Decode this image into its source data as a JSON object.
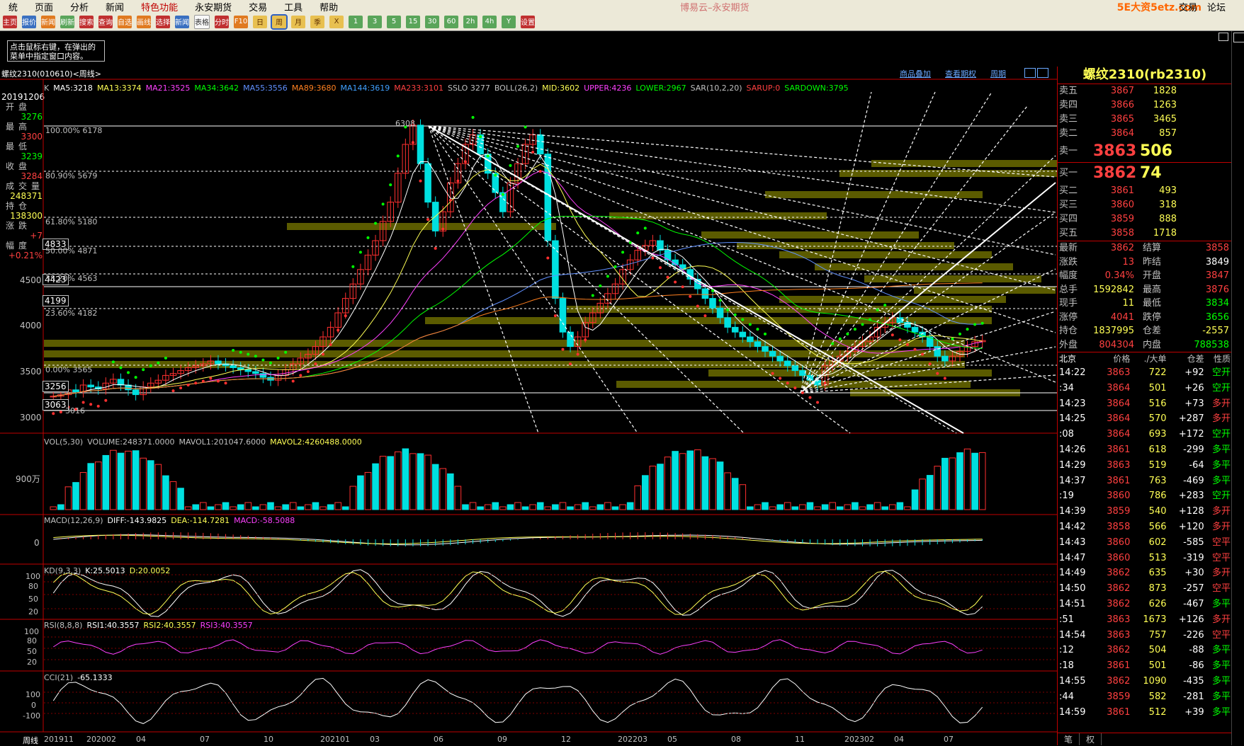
{
  "menu": [
    "统",
    "页面",
    "分析",
    "新闻",
    "特色功能",
    "永安期货",
    "交易",
    "工具",
    "帮助"
  ],
  "app_title": "博易云–永安期货",
  "menu_right": [
    "交易",
    "论坛"
  ],
  "watermark": "5E大资5etz.com",
  "toolbar": [
    "主页",
    "报价",
    "新闻",
    "刷新",
    "搜索",
    "查询",
    "自选",
    "画线",
    "选择",
    "新闻",
    "表格",
    "分时",
    "F10",
    "日",
    "周",
    "月",
    "季",
    "X",
    "1",
    "3",
    "5",
    "15",
    "30",
    "60",
    "2h",
    "4h",
    "Y",
    "设置"
  ],
  "note": "点击鼠标右键，在弹出的菜单中指定窗口内容。",
  "chart_header": {
    "title": "螺纹2310(010610)<周线>",
    "links": [
      "商品叠加",
      "查看期权",
      "周期"
    ]
  },
  "main_indicators": [
    {
      "text": "K",
      "color": "#c0c0c0"
    },
    {
      "text": "MA5:3218",
      "color": "#ffffff"
    },
    {
      "text": "MA13:3374",
      "color": "#ffff55"
    },
    {
      "text": "MA21:3525",
      "color": "#ff40ff"
    },
    {
      "text": "MA34:3642",
      "color": "#00ff00"
    },
    {
      "text": "MA55:3556",
      "color": "#6090ff"
    },
    {
      "text": "MA89:3680",
      "color": "#ff8020"
    },
    {
      "text": "MA144:3619",
      "color": "#40a0ff"
    },
    {
      "text": "MA233:3101",
      "color": "#ff4040"
    },
    {
      "text": "SSLO 3277",
      "color": "#c0c0c0"
    },
    {
      "text": "BOLL(26,2)",
      "color": "#c0c0c0"
    },
    {
      "text": "MID:3602",
      "color": "#ffff55"
    },
    {
      "text": "UPPER:4236",
      "color": "#ff40ff"
    },
    {
      "text": "LOWER:2967",
      "color": "#00ff00"
    },
    {
      "text": "SAR(10,2,20)",
      "color": "#c0c0c0"
    },
    {
      "text": "SARUP:0",
      "color": "#ff4040"
    },
    {
      "text": "SARDOWN:3795",
      "color": "#00ff00"
    }
  ],
  "sidebar": {
    "date": "20191206",
    "rows": [
      {
        "label": "开盘",
        "value": "3276",
        "color": "#00ff00"
      },
      {
        "label": "最高",
        "value": "3300",
        "color": "#ff4040"
      },
      {
        "label": "最低",
        "value": "3239",
        "color": "#00ff00"
      },
      {
        "label": "收盘",
        "value": "3284",
        "color": "#ff4040"
      },
      {
        "label": "成交量",
        "value": "248371",
        "color": "#ffff55"
      },
      {
        "label": "持仓",
        "value": "138300",
        "color": "#ffff55"
      },
      {
        "label": "涨跌",
        "value": "+7",
        "color": "#ff4040"
      },
      {
        "label": "幅度",
        "value": "+0.21%",
        "color": "#ff4040"
      }
    ]
  },
  "price_boxes": [
    "4833",
    "4423",
    "4199",
    "3256",
    "3063"
  ],
  "y_labels": [
    "4500",
    "4000",
    "3500",
    "3000"
  ],
  "fib_labels": [
    "100.00% 6178",
    "80.90% 5679",
    "61.80% 5180",
    "50.00% 4871",
    "38.20% 4563",
    "23.60% 4182",
    "0.00% 3565",
    "3016"
  ],
  "peak_label": "6308",
  "volume": {
    "title": [
      {
        "text": "VOL(5,30)",
        "color": "#c0c0c0"
      },
      {
        "text": "VOLUME:248371.0000",
        "color": "#c0c0c0"
      },
      {
        "text": "MAVOL1:201047.6000",
        "color": "#c0c0c0"
      },
      {
        "text": "MAVOL2:4260488.0000",
        "color": "#ffff55"
      }
    ],
    "y_label": "900万"
  },
  "macd": {
    "title": [
      {
        "text": "MACD(12,26,9)",
        "color": "#c0c0c0"
      },
      {
        "text": "DIFF:-143.9825",
        "color": "#ffffff"
      },
      {
        "text": "DEA:-114.7281",
        "color": "#ffff55"
      },
      {
        "text": "MACD:-58.5088",
        "color": "#ff40ff"
      }
    ],
    "y_label": "0"
  },
  "kd": {
    "title": [
      {
        "text": "KD(9,3,3)",
        "color": "#c0c0c0"
      },
      {
        "text": "K:25.5013",
        "color": "#ffffff"
      },
      {
        "text": "D:20.0052",
        "color": "#ffff55"
      }
    ],
    "y_labels": [
      "100",
      "80",
      "50",
      "20"
    ]
  },
  "rsi": {
    "title": [
      {
        "text": "RSI(8,8,8)",
        "color": "#c0c0c0"
      },
      {
        "text": "RSI1:40.3557",
        "color": "#ffffff"
      },
      {
        "text": "RSI2:40.3557",
        "color": "#ffff55"
      },
      {
        "text": "RSI3:40.3557",
        "color": "#ff40ff"
      }
    ],
    "y_labels": [
      "100",
      "80",
      "50",
      "20"
    ]
  },
  "cci": {
    "title": [
      {
        "text": "CCI(21)",
        "color": "#c0c0c0"
      },
      {
        "text": "-65.1333",
        "color": "#ffffff"
      }
    ],
    "y_labels": [
      "100",
      "0",
      "-100"
    ]
  },
  "x_axis": {
    "label": "周线",
    "ticks": [
      "201911",
      "202002",
      "04",
      "07",
      "10",
      "202101",
      "03",
      "06",
      "09",
      "12",
      "202203",
      "05",
      "08",
      "11",
      "202302",
      "04",
      "07"
    ]
  },
  "quote": {
    "title": "螺纹2310(rb2310)",
    "asks": [
      {
        "label": "卖五",
        "price": "3867",
        "vol": "1828"
      },
      {
        "label": "卖四",
        "price": "3866",
        "vol": "1263"
      },
      {
        "label": "卖三",
        "price": "3865",
        "vol": "3465"
      },
      {
        "label": "卖二",
        "price": "3864",
        "vol": "857"
      },
      {
        "label": "卖一",
        "price": "3863",
        "vol": "506"
      }
    ],
    "bids": [
      {
        "label": "买一",
        "price": "3862",
        "vol": "74"
      },
      {
        "label": "买二",
        "price": "3861",
        "vol": "493"
      },
      {
        "label": "买三",
        "price": "3860",
        "vol": "318"
      },
      {
        "label": "买四",
        "price": "3859",
        "vol": "888"
      },
      {
        "label": "买五",
        "price": "3858",
        "vol": "1718"
      }
    ],
    "stats": [
      {
        "l1": "最新",
        "v1": "3862",
        "c1": "#ff4040",
        "l2": "结算",
        "v2": "3858",
        "c2": "#ff4040"
      },
      {
        "l1": "涨跌",
        "v1": "13",
        "c1": "#ff4040",
        "l2": "昨结",
        "v2": "3849",
        "c2": "#ffffff"
      },
      {
        "l1": "幅度",
        "v1": "0.34%",
        "c1": "#ff4040",
        "l2": "开盘",
        "v2": "3847",
        "c2": "#ff4040"
      },
      {
        "l1": "总手",
        "v1": "1592842",
        "c1": "#ffff55",
        "l2": "最高",
        "v2": "3876",
        "c2": "#ff4040"
      },
      {
        "l1": "现手",
        "v1": "11",
        "c1": "#ffff55",
        "l2": "最低",
        "v2": "3834",
        "c2": "#00ff00"
      },
      {
        "l1": "涨停",
        "v1": "4041",
        "c1": "#ff4040",
        "l2": "跌停",
        "v2": "3656",
        "c2": "#00ff00"
      },
      {
        "l1": "持仓",
        "v1": "1837995",
        "c1": "#ffff55",
        "l2": "仓差",
        "v2": "-2557",
        "c2": "#ffff55"
      },
      {
        "l1": "外盘",
        "v1": "804304",
        "c1": "#ff4040",
        "l2": "内盘",
        "v2": "788538",
        "c2": "#00ff00"
      }
    ],
    "tick_header": [
      "北京",
      "价格",
      "./大单",
      "仓差",
      "性质"
    ],
    "ticks": [
      {
        "t": "14:22",
        "p": "3863",
        "v": "722",
        "c": "+92",
        "n": "空开",
        "cc": "#ffffff",
        "nc": "#00ff00"
      },
      {
        "t": ":34",
        "p": "3864",
        "v": "501",
        "c": "+26",
        "n": "空开",
        "cc": "#ffffff",
        "nc": "#00ff00"
      },
      {
        "t": "14:23",
        "p": "3864",
        "v": "516",
        "c": "+73",
        "n": "多开",
        "cc": "#ffffff",
        "nc": "#ff4040"
      },
      {
        "t": "14:25",
        "p": "3864",
        "v": "570",
        "c": "+287",
        "n": "多开",
        "cc": "#ffffff",
        "nc": "#ff4040"
      },
      {
        "t": ":08",
        "p": "3864",
        "v": "693",
        "c": "+172",
        "n": "空开",
        "cc": "#ffffff",
        "nc": "#00ff00"
      },
      {
        "t": "14:26",
        "p": "3861",
        "v": "618",
        "c": "-299",
        "n": "多平",
        "cc": "#ffffff",
        "nc": "#00ff00"
      },
      {
        "t": "14:29",
        "p": "3863",
        "v": "519",
        "c": "-64",
        "n": "多平",
        "cc": "#ffffff",
        "nc": "#00ff00"
      },
      {
        "t": "14:37",
        "p": "3861",
        "v": "763",
        "c": "-469",
        "n": "多平",
        "cc": "#ffffff",
        "nc": "#00ff00"
      },
      {
        "t": ":19",
        "p": "3860",
        "v": "786",
        "c": "+283",
        "n": "空开",
        "cc": "#ffffff",
        "nc": "#00ff00"
      },
      {
        "t": "14:39",
        "p": "3859",
        "v": "540",
        "c": "+128",
        "n": "多开",
        "cc": "#ffffff",
        "nc": "#ff4040"
      },
      {
        "t": "14:42",
        "p": "3858",
        "v": "566",
        "c": "+120",
        "n": "多开",
        "cc": "#ffffff",
        "nc": "#ff4040"
      },
      {
        "t": "14:43",
        "p": "3860",
        "v": "602",
        "c": "-585",
        "n": "空平",
        "cc": "#ffffff",
        "nc": "#ff4040"
      },
      {
        "t": "14:47",
        "p": "3860",
        "v": "513",
        "c": "-319",
        "n": "空平",
        "cc": "#ffffff",
        "nc": "#ff4040"
      },
      {
        "t": "14:49",
        "p": "3862",
        "v": "635",
        "c": "+30",
        "n": "多开",
        "cc": "#ffffff",
        "nc": "#ff4040"
      },
      {
        "t": "14:50",
        "p": "3862",
        "v": "873",
        "c": "-257",
        "n": "空平",
        "cc": "#ffffff",
        "nc": "#ff4040"
      },
      {
        "t": "14:51",
        "p": "3862",
        "v": "626",
        "c": "-467",
        "n": "多平",
        "cc": "#ffffff",
        "nc": "#00ff00"
      },
      {
        "t": ":51",
        "p": "3863",
        "v": "1673",
        "c": "+126",
        "n": "多开",
        "cc": "#ffffff",
        "nc": "#ff4040"
      },
      {
        "t": "14:54",
        "p": "3863",
        "v": "757",
        "c": "-226",
        "n": "空平",
        "cc": "#ffffff",
        "nc": "#ff4040"
      },
      {
        "t": ":12",
        "p": "3862",
        "v": "504",
        "c": "-88",
        "n": "多平",
        "cc": "#ffffff",
        "nc": "#00ff00"
      },
      {
        "t": ":18",
        "p": "3861",
        "v": "501",
        "c": "-86",
        "n": "多平",
        "cc": "#ffffff",
        "nc": "#00ff00"
      },
      {
        "t": "14:55",
        "p": "3862",
        "v": "1090",
        "c": "-435",
        "n": "多平",
        "cc": "#ffffff",
        "nc": "#00ff00"
      },
      {
        "t": ":44",
        "p": "3859",
        "v": "582",
        "c": "-281",
        "n": "多平",
        "cc": "#ffffff",
        "nc": "#00ff00"
      },
      {
        "t": "14:59",
        "p": "3861",
        "v": "512",
        "c": "+39",
        "n": "多平",
        "cc": "#ffffff",
        "nc": "#00ff00"
      }
    ],
    "footer": [
      "笔",
      "权"
    ]
  },
  "chart_data": {
    "type": "candlestick",
    "period": "weekly",
    "symbol": "螺纹2310",
    "y_ticks": [
      3000,
      3500,
      4000,
      4500
    ],
    "ylim": [
      2900,
      6400
    ],
    "x_ticks": [
      "201911",
      "202002",
      "04",
      "07",
      "10",
      "202101",
      "03",
      "06",
      "09",
      "12",
      "202203",
      "05",
      "08",
      "11",
      "202302",
      "04",
      "07"
    ],
    "closes": [
      3284,
      3300,
      3350,
      3330,
      3400,
      3380,
      3360,
      3420,
      3460,
      3400,
      3350,
      3300,
      3380,
      3420,
      3450,
      3500,
      3520,
      3550,
      3580,
      3600,
      3620,
      3650,
      3620,
      3600,
      3580,
      3560,
      3540,
      3520,
      3480,
      3450,
      3500,
      3560,
      3620,
      3680,
      3720,
      3800,
      3900,
      4000,
      4150,
      4300,
      4450,
      4600,
      4750,
      4900,
      5100,
      5300,
      5600,
      5900,
      6100,
      5700,
      5300,
      5000,
      5200,
      5500,
      5700,
      5900,
      6000,
      5800,
      5600,
      5400,
      5200,
      5500,
      5700,
      5900,
      6000,
      5800,
      4900,
      4300,
      3950,
      3800,
      3900,
      4050,
      4150,
      4250,
      4350,
      4450,
      4600,
      4700,
      4800,
      4850,
      4900,
      4800,
      4700,
      4650,
      4600,
      4500,
      4400,
      4300,
      4200,
      4100,
      4000,
      3950,
      3900,
      3850,
      3800,
      3750,
      3700,
      3650,
      3600,
      3550,
      3500,
      3450,
      3400,
      3600,
      3650,
      3700,
      3750,
      3800,
      3850,
      3900,
      4000,
      4050,
      4100,
      4050,
      4000,
      3950,
      3900,
      3800,
      3700,
      3650,
      3700,
      3750,
      3800,
      3850,
      3862
    ],
    "series": [
      {
        "name": "MA5",
        "value": 3218
      },
      {
        "name": "MA13",
        "value": 3374
      },
      {
        "name": "MA21",
        "value": 3525
      },
      {
        "name": "MA34",
        "value": 3642
      },
      {
        "name": "MA55",
        "value": 3556
      },
      {
        "name": "MA89",
        "value": 3680
      },
      {
        "name": "MA144",
        "value": 3619
      },
      {
        "name": "MA233",
        "value": 3101
      }
    ],
    "kd": {
      "k": 25.5013,
      "d": 20.0052
    },
    "rsi": [
      40.3557,
      40.3557,
      40.3557
    ],
    "cci": -65.1333,
    "macd": {
      "diff": -143.9825,
      "dea": -114.7281,
      "macd": -58.5088
    },
    "volume": {
      "volume": 248371,
      "mavol1": 201047.6,
      "mavol2": 4260488
    }
  }
}
